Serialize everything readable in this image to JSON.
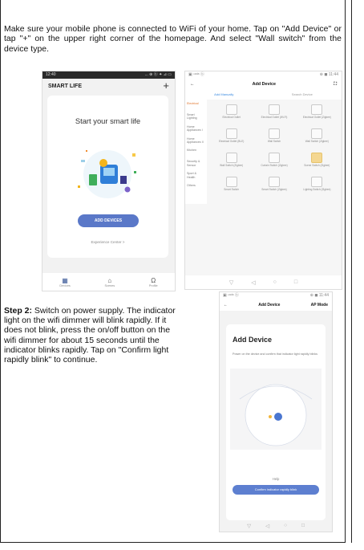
{
  "intro_text": "Make sure your mobile phone is connected to WiFi of your home. Tap on \"Add Device\" or tap \"+\" on the upper right corner of the homepage. And select \"Wall switch\" from the device type.",
  "phone1": {
    "status_time": "12:40",
    "status_icons": "... ⊕ ⓑ ✦ ⊿ ▭",
    "app_title": "SMART LIFE",
    "plus": "+",
    "headline": "Start your smart life",
    "add_button": "ADD DEVICES",
    "experience": "Experience Center >",
    "nav": [
      "Devices",
      "Scenes",
      "Profile"
    ]
  },
  "phone2": {
    "status_left": "▣ ⁿᵃᵈᵃ ⓑ",
    "status_right": "⊕ ◼ 11:44",
    "back": "←",
    "title": "Add Device",
    "scan": "⛶",
    "tabs": [
      "Add Manually",
      "Search Device"
    ],
    "side": [
      "Electrical",
      "Smart Lighting",
      "Home Appliances I",
      "Home Appliances II",
      "Kitchen",
      "Security & Sensor",
      "Sport & Health",
      "Others"
    ],
    "devices": [
      {
        "label": "Electrical Outlet",
        "hl": false
      },
      {
        "label": "Electrical Outlet (Wi-Fi)",
        "hl": false
      },
      {
        "label": "Electrical Outlet (Zigbee)",
        "hl": false
      },
      {
        "label": "Electrical Outlet (BLE)",
        "hl": false
      },
      {
        "label": "Wall Switch",
        "hl": false
      },
      {
        "label": "Wall Switch (Zigbee)",
        "hl": false
      },
      {
        "label": "Wall Switch (Zigbee)",
        "hl": false
      },
      {
        "label": "Curtain Switch (Zigbee)",
        "hl": false
      },
      {
        "label": "Scene Switch (Zigbee)",
        "hl": true
      },
      {
        "label": "Smart Switch",
        "hl": false
      },
      {
        "label": "Smart Switch (Zigbee)",
        "hl": false
      },
      {
        "label": "Lighting Switch (Zigbee)",
        "hl": false
      }
    ],
    "nav": [
      "▽",
      "◁",
      "○",
      "□"
    ]
  },
  "step2": {
    "label": "Step 2:",
    "text": " Switch on power supply. The indicator light on the wifi dimmer will blink rapidly. If it does not blink, press the on/off button on the wifi dimmer for about 15 seconds until the indicator blinks rapidly. Tap on \"Confirm light rapidly blink\" to continue."
  },
  "phone3": {
    "status_left": "▣ ⁿᵃᵈᵃ ⓑ",
    "status_right": "⊕ ◼ 11:44",
    "back": "←",
    "title": "Add Device",
    "mode": "AP Mode",
    "card_title": "Add Device",
    "desc": "Power on the device and confirm that indicator light rapidly blinks",
    "help": "Help",
    "confirm": "Confirm indicator rapidly blink",
    "nav": [
      "▽",
      "◁",
      "○",
      "□"
    ]
  }
}
